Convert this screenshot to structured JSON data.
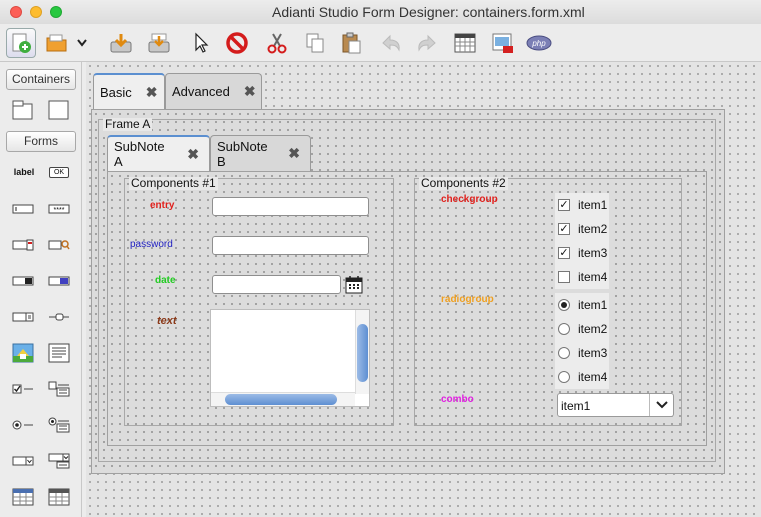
{
  "window": {
    "title": "Adianti Studio Form Designer: containers.form.xml"
  },
  "palette": {
    "containers_label": "Containers",
    "forms_label": "Forms",
    "label_item": "label",
    "ok_item": "OK"
  },
  "main_tabs": [
    {
      "label": "Basic",
      "active": true
    },
    {
      "label": "Advanced",
      "active": false
    }
  ],
  "frame": {
    "title": "Frame A"
  },
  "sub_tabs": [
    {
      "label": "SubNote A",
      "active": true
    },
    {
      "label": "SubNote B",
      "active": false
    }
  ],
  "components1": {
    "title": "Components #1",
    "entry_label": "entry",
    "password_label": "password",
    "date_label": "date",
    "text_label": "text",
    "entry_value": "",
    "password_value": "",
    "date_value": ""
  },
  "components2": {
    "title": "Components #2",
    "checkgroup_label": "checkgroup",
    "radiogroup_label": "radiogroup",
    "combo_label": "combo",
    "check_items": [
      {
        "label": "item1",
        "checked": true
      },
      {
        "label": "item2",
        "checked": true
      },
      {
        "label": "item3",
        "checked": true
      },
      {
        "label": "item4",
        "checked": false
      }
    ],
    "radio_items": [
      {
        "label": "item1",
        "selected": true
      },
      {
        "label": "item2",
        "selected": false
      },
      {
        "label": "item3",
        "selected": false
      },
      {
        "label": "item4",
        "selected": false
      }
    ],
    "combo_value": "item1"
  },
  "colors": {
    "entry": "#e0201c",
    "password": "#2020c0",
    "date": "#22cc22",
    "text": "#8b3a1a",
    "checkgroup": "#e0201c",
    "radiogroup": "#f0a020",
    "combo": "#e020e0"
  },
  "icons": {
    "toolbar": [
      "new-form-icon",
      "open-icon",
      "dropdown-arrow-icon",
      "save-icon",
      "save-as-icon",
      "pointer-icon",
      "delete-icon",
      "cut-icon",
      "copy-icon",
      "paste-icon",
      "undo-icon",
      "redo-icon",
      "grid-icon",
      "preview-icon",
      "php-icon"
    ],
    "palette": [
      "frame-icon",
      "panel-icon",
      "label-widget-icon",
      "button-widget-icon",
      "entry-widget-icon",
      "password-widget-icon",
      "date-widget-icon",
      "seek-widget-icon",
      "spinner-widget-icon",
      "color-widget-icon",
      "file-widget-icon",
      "slider-widget-icon",
      "image-widget-icon",
      "text-widget-icon",
      "check-widget-icon",
      "checkgroup-widget-icon",
      "radio-widget-icon",
      "radiogroup-widget-icon",
      "combo-widget-icon",
      "multicombo-widget-icon",
      "datagrid-widget-icon",
      "table-widget-icon"
    ]
  }
}
